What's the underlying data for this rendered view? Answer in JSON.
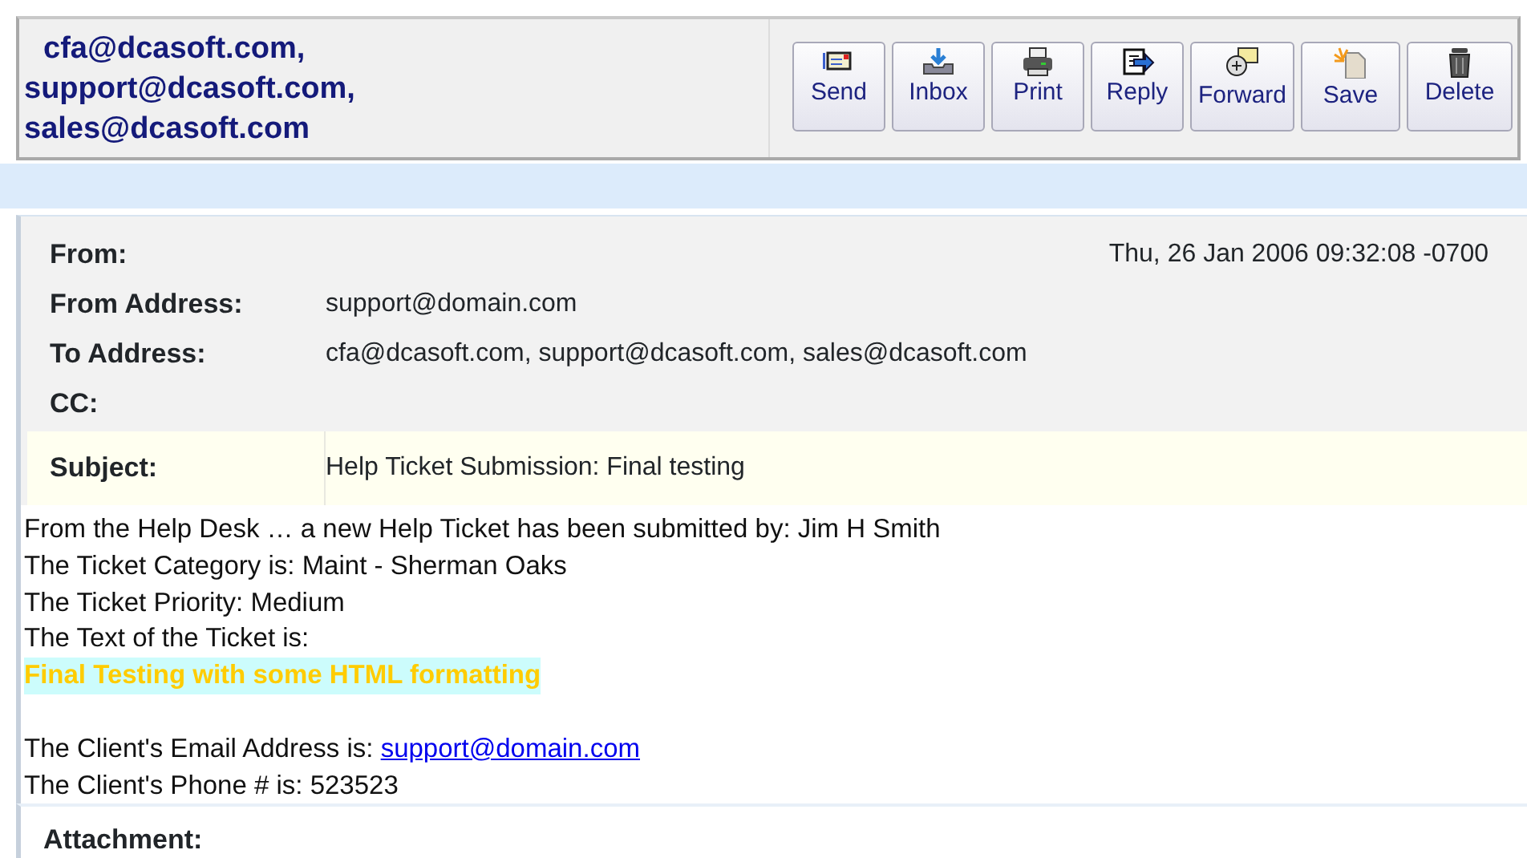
{
  "header": {
    "recipients": [
      "cfa@dcasoft.com,",
      "support@dcasoft.com,",
      "sales@dcasoft.com"
    ]
  },
  "toolbar": [
    {
      "label": "Send"
    },
    {
      "label": "Inbox"
    },
    {
      "label": "Print"
    },
    {
      "label": "Reply"
    },
    {
      "label": "Forward"
    },
    {
      "label": "Save"
    },
    {
      "label": "Delete"
    }
  ],
  "fields": [
    {
      "label": "From:",
      "value": "Thu, 26 Jan 2006 09:32:08 -0700",
      "kind": "date"
    },
    {
      "label": "From Address:",
      "value": "support@domain.com",
      "kind": "plain"
    },
    {
      "label": "To Address:",
      "value": "cfa@dcasoft.com, support@dcasoft.com, sales@dcasoft.com",
      "kind": "plain"
    },
    {
      "label": "CC:",
      "kind": "plain"
    },
    {
      "label": "Subject:",
      "value": "Help Ticket Submission: Final testing",
      "kind": "subject"
    }
  ],
  "body": [
    {
      "kind": "text",
      "text": "From the Help Desk … a new Help Ticket has been submitted by: Jim H Smith"
    },
    {
      "kind": "text",
      "text": "The Ticket Category is: Maint - Sherman Oaks"
    },
    {
      "kind": "text",
      "text": "The Ticket Priority: Medium"
    },
    {
      "kind": "text",
      "text": "The Text of the Ticket is:"
    },
    {
      "kind": "highlight",
      "text": "Final Testing with some HTML formatting"
    },
    {
      "kind": "spacer"
    },
    {
      "kind": "text",
      "text": "The Client's Email Address is: ",
      "link": "support@domain.com"
    },
    {
      "kind": "text",
      "text": "The Client's Phone # is: 523523"
    }
  ],
  "attachment": {
    "label": "Attachment:"
  }
}
